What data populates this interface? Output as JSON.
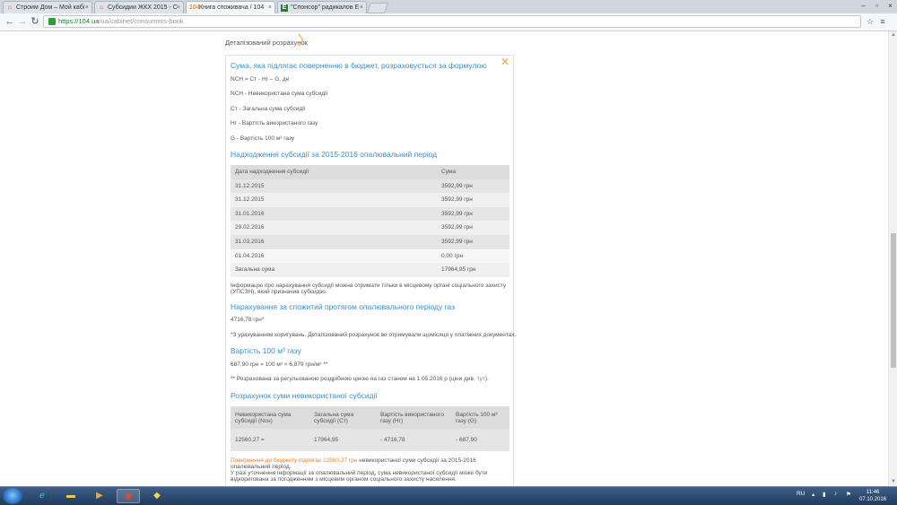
{
  "browser": {
    "tabs": [
      {
        "title": "Строим Дом – Мой кабі",
        "icon": "house-icon"
      },
      {
        "title": "Субсидии ЖКХ 2015 - С",
        "icon": "house-icon"
      },
      {
        "title": "Книга споживача / 104",
        "icon": "104-icon"
      },
      {
        "title": "\"Спонсор\" радикалов Е",
        "icon": "e-icon"
      }
    ],
    "url_host": "https://104.ua",
    "url_path": "/ua/cabinet/consumers-book"
  },
  "page": {
    "breadcrumb": "Деталізований розрахунок",
    "formula_title": "Сума, яка підлягає поверненню в бюджет, розраховується за формулою",
    "formula": "NСН = Cт - Hг – G, де",
    "definitions": [
      "- Невикористана сума субсидії",
      "- Загальна сума субсидії",
      "- Вартість використаного газу",
      "- Вартість 100 м³ газу"
    ],
    "def_symbols": [
      "NСН",
      "Cт",
      "Hг",
      "G"
    ],
    "receipts_title": "Надходження субсидії за 2015-2016 опалювальний період",
    "receipts_table": {
      "headers": [
        "Дата надходження субсидії",
        "Сума"
      ],
      "rows": [
        [
          "31.12.2015",
          "3592,99 грн"
        ],
        [
          "31.12.2015",
          "3592,99 грн"
        ],
        [
          "31.01.2016",
          "3592,99 грн"
        ],
        [
          "29.02.2016",
          "3592,99 грн"
        ],
        [
          "31.03.2016",
          "3592,99 грн"
        ],
        [
          "01.04.2016",
          "0,00 грн"
        ],
        [
          "Загальна сума",
          "17964,95 грн"
        ]
      ]
    },
    "receipts_note": "Інформацію про нарахування субсидії можна отримати тільки в місцевому органі соціального захисту (УПСЗН), який призначив субсидію.",
    "accrual_title": "Нарахування за спожитий протягом опалювального періоду газ",
    "accrual_value": "4716,78 грн*",
    "accrual_note": "*З урахуванням коригувань. Деталізований розрахунок ви отримували щомісяця у платіжних документах.",
    "cost_title": "Вартість 100 м³ газу",
    "cost_formula": "687,90 грн = 100 м³ × 6,879 грн/м³ **",
    "cost_note_prefix": "** Розрахована за регульованою роздрібною ціною на газ станом на 1.05.2016 р (ціни див.",
    "cost_note_link": "тут",
    "cost_note_suffix": ").",
    "calc_title": "Розрахунок суми невикористаної субсидії",
    "calc_table": {
      "headers": [
        "Невикористана сума субсидії (Nсн)",
        "Загальна сума субсидії (Ст)",
        "Вартість використаного газу (Нг)",
        "Вартість 100 м³ газу (G)"
      ],
      "values": [
        "12560,27 =",
        "17964,95",
        "- 4716,78",
        "- 687,90"
      ]
    },
    "result_orange": "Повернення до бюджету підлягає 12560,27 грн",
    "result_rest": "невикористаної суми субсидії за 2015-2016 опалювальний період.",
    "result_note": "У разі уточнення інформації за опалювальний період, сума невикористаної субсидії може бути відкоригована за погодженням з місцевим органом соціального захисту населення."
  },
  "taskbar": {
    "lang": "RU",
    "time": "11:46",
    "date": "07.10.2016"
  }
}
